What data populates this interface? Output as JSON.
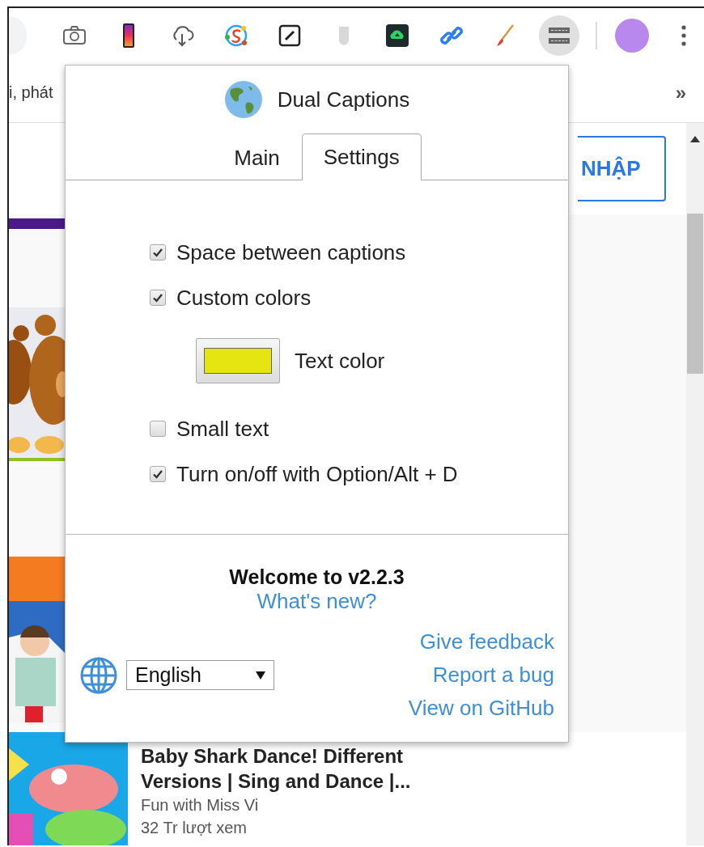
{
  "toolbar": {
    "extensions": [
      {
        "kind": "camera",
        "selected": false
      },
      {
        "kind": "phone",
        "selected": false
      },
      {
        "kind": "cloud",
        "selected": false
      },
      {
        "kind": "ring",
        "selected": false
      },
      {
        "kind": "edit",
        "selected": false
      },
      {
        "kind": "shield",
        "selected": false
      },
      {
        "kind": "upload",
        "selected": false
      },
      {
        "kind": "link",
        "selected": false
      },
      {
        "kind": "brush",
        "selected": false
      },
      {
        "kind": "captions",
        "selected": true
      }
    ]
  },
  "bookmarks_bar": {
    "text": "i, phát",
    "overflow": "»"
  },
  "page": {
    "login_button": "NHẬP",
    "video": {
      "title": "Baby Shark Dance! Different Versions | Sing and Dance |...",
      "channel": "Fun with Miss Vi",
      "views": "32 Tr lượt xem"
    }
  },
  "popup": {
    "title": "Dual Captions",
    "tabs": [
      {
        "label": "Main",
        "selected": false
      },
      {
        "label": "Settings",
        "selected": true
      }
    ],
    "settings": [
      {
        "kind": "checkbox",
        "label": "Space between captions",
        "checked": true
      },
      {
        "kind": "checkbox",
        "label": "Custom colors",
        "checked": true
      },
      {
        "kind": "color",
        "label": "Text color",
        "color": "#e5e512"
      },
      {
        "kind": "checkbox",
        "label": "Small text",
        "checked": false
      },
      {
        "kind": "checkbox",
        "label": "Turn on/off with Option/Alt + D",
        "checked": true
      }
    ],
    "welcome": "Welcome to v2.2.3",
    "whats_new": "What's new?",
    "language": "English",
    "links": [
      "Give feedback",
      "Report a bug",
      "View on GitHub"
    ]
  }
}
